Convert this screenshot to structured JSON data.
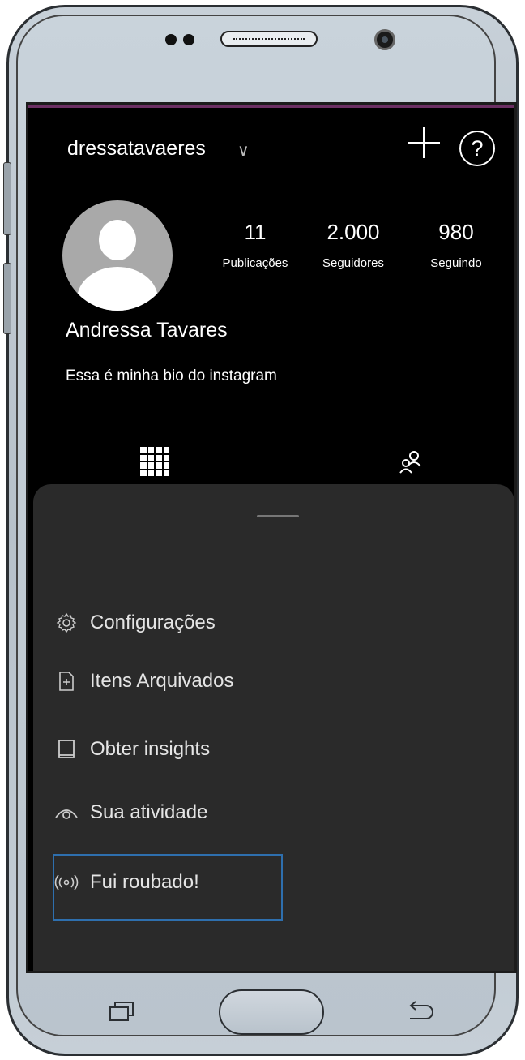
{
  "profile": {
    "username": "dressatavaeres",
    "full_name": "Andressa Tavares",
    "bio": "Essa é minha bio do instagram"
  },
  "stats": [
    {
      "value": "11",
      "label": "Publicações"
    },
    {
      "value": "2.000",
      "label": "Seguidores"
    },
    {
      "value": "980",
      "label": "Seguindo"
    }
  ],
  "header": {
    "help_label": "?"
  },
  "menu": {
    "items": [
      {
        "label": "Configurações",
        "icon": "gear-icon"
      },
      {
        "label": "Itens Arquivados",
        "icon": "archive-file-icon"
      },
      {
        "label": "Obter insights",
        "icon": "insights-icon"
      },
      {
        "label": "Sua atividade",
        "icon": "activity-eye-icon"
      },
      {
        "label": "Fui roubado!",
        "icon": "broadcast-icon"
      }
    ]
  },
  "colors": {
    "screen_bg": "#000000",
    "sheet_bg": "#2a2a2a",
    "highlight_border": "#2e6fae",
    "accent_line": "#6b2f63"
  }
}
